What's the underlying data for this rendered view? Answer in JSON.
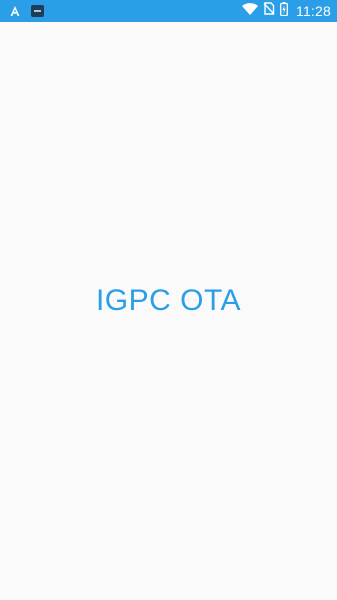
{
  "status_bar": {
    "time": "11:28",
    "icons": [
      "a-notification-icon",
      "app-notification-icon",
      "wifi-icon",
      "no-sim-icon",
      "battery-charging-icon"
    ],
    "background_color": "#2b9ee8"
  },
  "splash": {
    "title": "IGPC OTA",
    "title_color": "#2b9ee8",
    "background_color": "#fafafa"
  }
}
